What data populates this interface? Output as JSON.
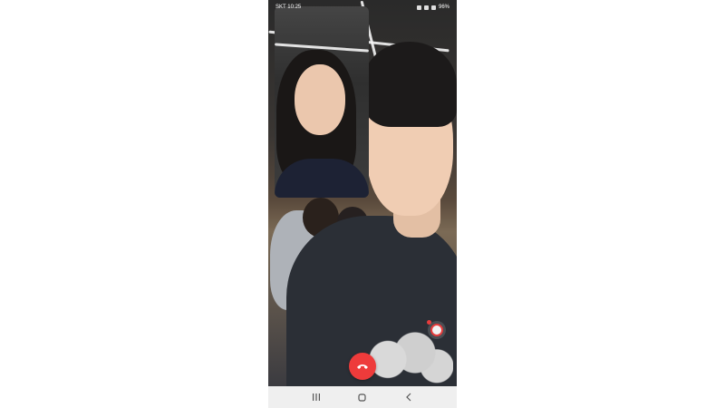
{
  "status_bar": {
    "time": "SKT 10:25",
    "icons": [
      "alarm-icon",
      "wifi-icon",
      "signal-icon",
      "battery-icon"
    ],
    "battery": "96%"
  },
  "call": {
    "end_call_color": "#ee3b3b",
    "effects_accent": "#e63c3c"
  },
  "nav": {
    "items": [
      "recent-apps-icon",
      "home-icon",
      "back-icon"
    ]
  }
}
